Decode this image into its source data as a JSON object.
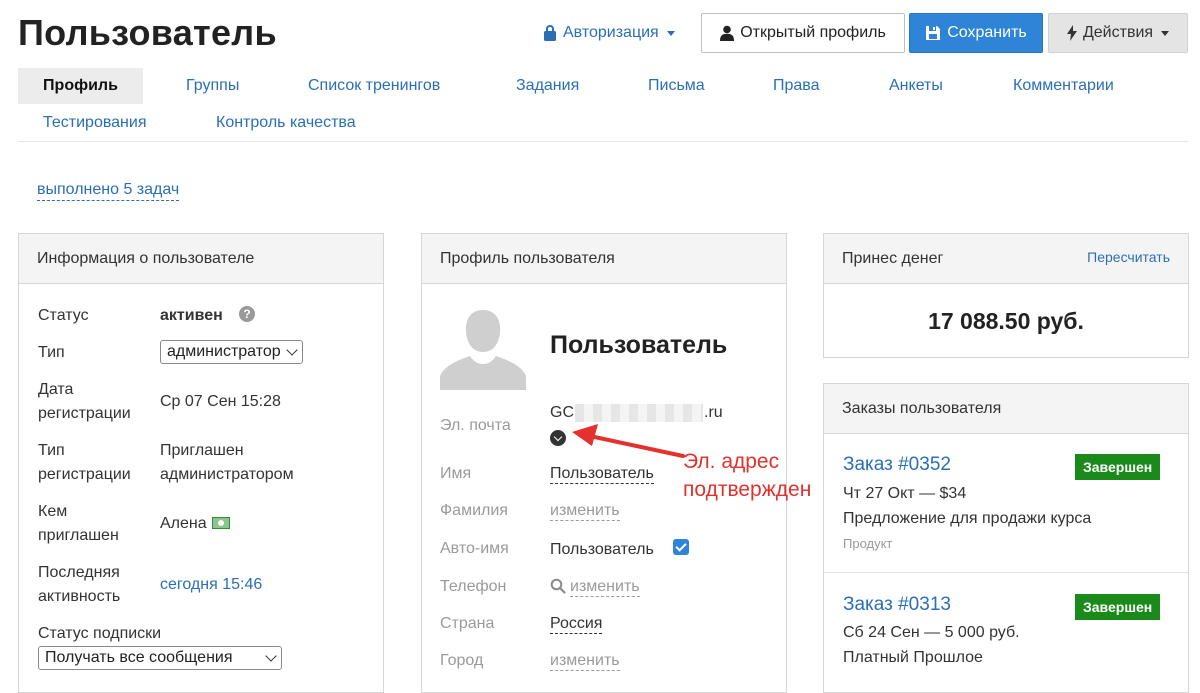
{
  "header": {
    "title": "Пользователь",
    "auth_label": "Авторизация",
    "open_profile_label": "Открытый профиль",
    "save_label": "Сохранить",
    "actions_label": "Действия"
  },
  "tabs": [
    {
      "label": "Профиль",
      "active": true
    },
    {
      "label": "Группы"
    },
    {
      "label": "Список тренингов"
    },
    {
      "label": "Задания"
    },
    {
      "label": "Письма"
    },
    {
      "label": "Права"
    },
    {
      "label": "Анкеты"
    },
    {
      "label": "Комментарии"
    },
    {
      "label": "Тестирования"
    },
    {
      "label": "Контроль качества"
    }
  ],
  "tasks_link": "выполнено 5 задач",
  "user_info": {
    "title": "Информация о пользователе",
    "status_label": "Статус",
    "status_value": "активен",
    "type_label": "Тип",
    "type_value": "администратор",
    "reg_date_label_1": "Дата",
    "reg_date_label_2": "регистрации",
    "reg_date_value": "Ср 07 Сен 15:28",
    "reg_type_label_1": "Тип",
    "reg_type_label_2": "регистрации",
    "reg_type_value_1": "Приглашен",
    "reg_type_value_2": "администратором",
    "invited_label_1": "Кем",
    "invited_label_2": "приглашен",
    "invited_value": "Алена",
    "last_active_label_1": "Последняя",
    "last_active_label_2": "активность",
    "last_active_value": "сегодня 15:46",
    "subscription_label": "Статус подписки",
    "subscription_value": "Получать все сообщения"
  },
  "profile": {
    "title": "Профиль пользователя",
    "name_heading": "Пользователь",
    "email_label": "Эл. почта",
    "email_prefix": "GC",
    "email_suffix": ".ru",
    "first_name_label": "Имя",
    "first_name_value": "Пользователь",
    "last_name_label": "Фамилия",
    "last_name_value": "изменить",
    "auto_name_label": "Авто-имя",
    "auto_name_value": "Пользователь",
    "phone_label": "Телефон",
    "phone_value": "изменить",
    "country_label": "Страна",
    "country_value": "Россия",
    "city_label": "Город",
    "city_value": "изменить"
  },
  "annotation": {
    "line1": "Эл. адрес",
    "line2": "подтвержден",
    "color": "#e3312d"
  },
  "money": {
    "title": "Принес денег",
    "recalc_label": "Пересчитать",
    "amount": "17 088.50 руб."
  },
  "orders": {
    "title": "Заказы пользователя",
    "items": [
      {
        "number": "Заказ #0352",
        "status": "Завершен",
        "date": "Чт 27 Окт — $34",
        "name": "Предложение для продажи курса",
        "type": "Продукт"
      },
      {
        "number": "Заказ #0313",
        "status": "Завершен",
        "date": "Сб 24 Сен — 5 000 руб.",
        "name": "Платный Прошлое"
      }
    ]
  },
  "colors": {
    "link": "#2a6fb6",
    "primary": "#2e84d6",
    "success": "#1a8a1a"
  }
}
